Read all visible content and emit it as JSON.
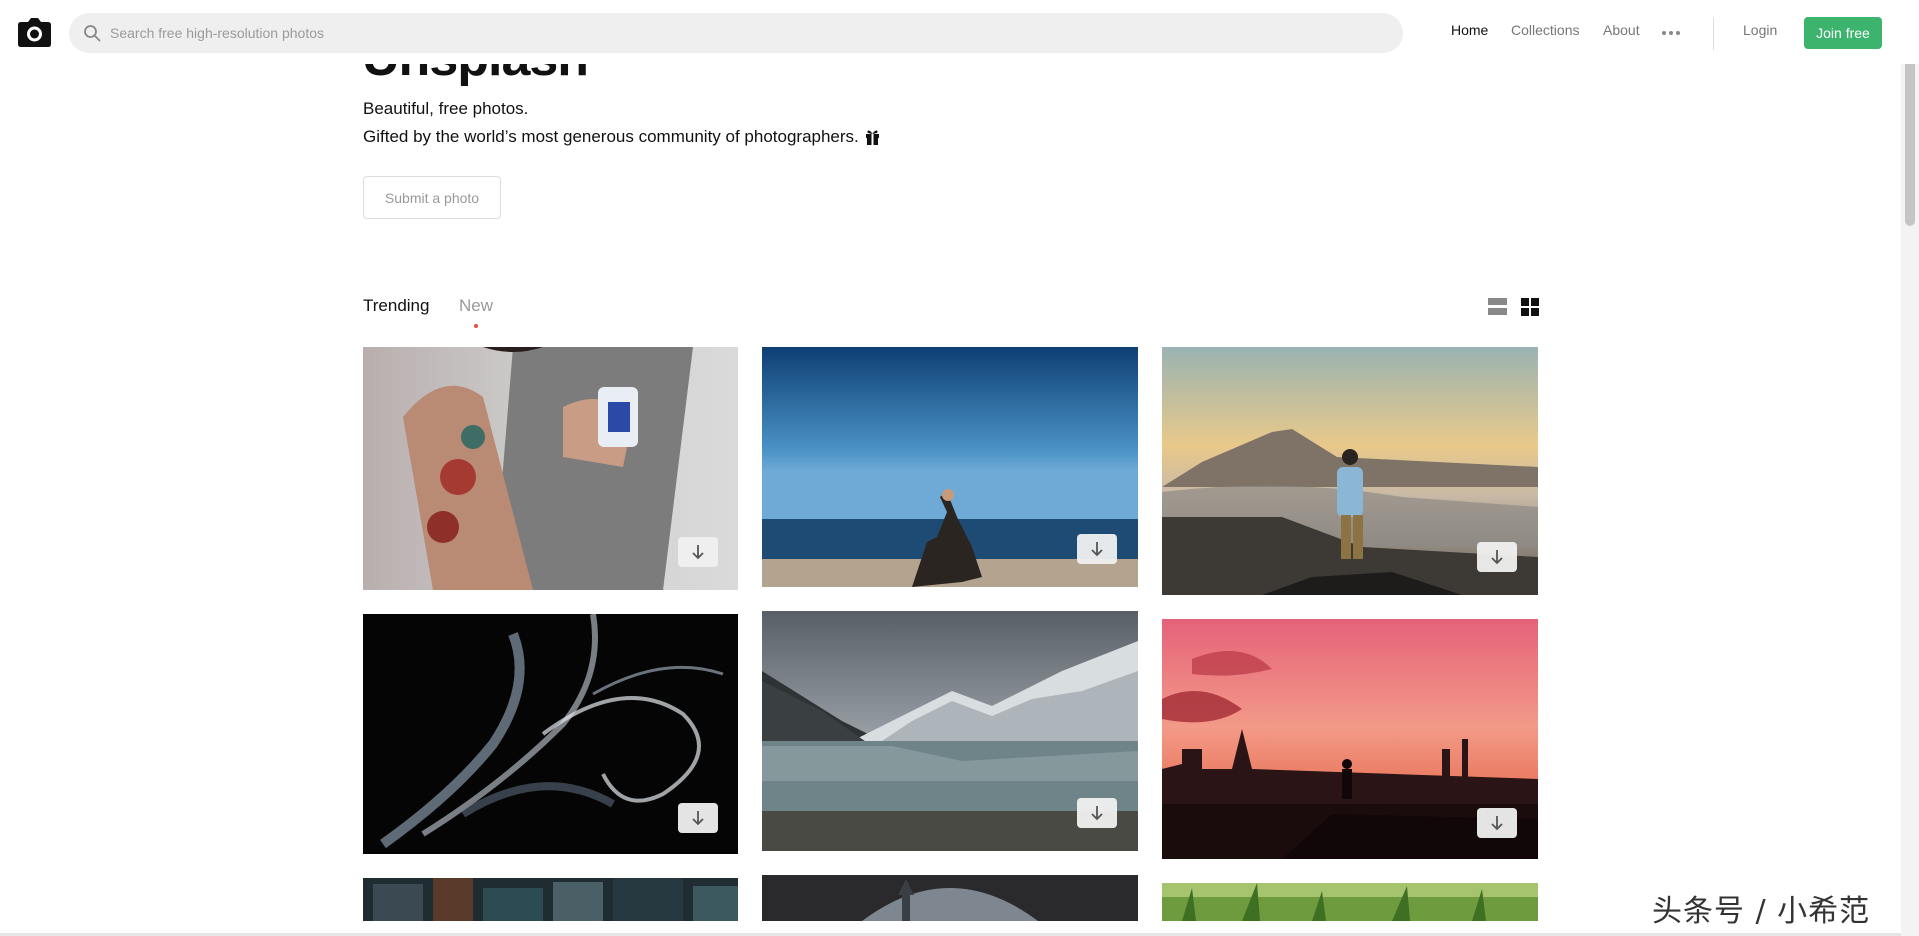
{
  "header": {
    "search_placeholder": "Search free high-resolution photos",
    "nav": [
      "Home",
      "Collections",
      "About"
    ],
    "login": "Login",
    "join": "Join free"
  },
  "hero": {
    "title": "Unsplash",
    "subtitle_1": "Beautiful, free photos.",
    "subtitle_2": "Gifted by the world’s most generous community of photographers.",
    "submit_label": "Submit a photo"
  },
  "tabs": [
    "Trending",
    "New"
  ],
  "view_modes": [
    "list-view-icon",
    "grid-view-icon"
  ],
  "photos": [
    {
      "name": "photo-tattoo-mug",
      "icon": "download-arrow-icon"
    },
    {
      "name": "photo-yoga-sea",
      "icon": "download-arrow-icon"
    },
    {
      "name": "photo-man-mountain-sunset",
      "icon": "download-arrow-icon"
    },
    {
      "name": "photo-smoke",
      "icon": "download-arrow-icon"
    },
    {
      "name": "photo-snowy-mountain-lake",
      "icon": "download-arrow-icon"
    },
    {
      "name": "photo-city-pink-sunset",
      "icon": "download-arrow-icon"
    },
    {
      "name": "photo-city-street"
    },
    {
      "name": "photo-arch-church"
    },
    {
      "name": "photo-grass"
    }
  ],
  "colors": {
    "accent_green": "#3cb46e",
    "new_dot": "#e25141"
  },
  "watermark": "头条号 / 小希范"
}
